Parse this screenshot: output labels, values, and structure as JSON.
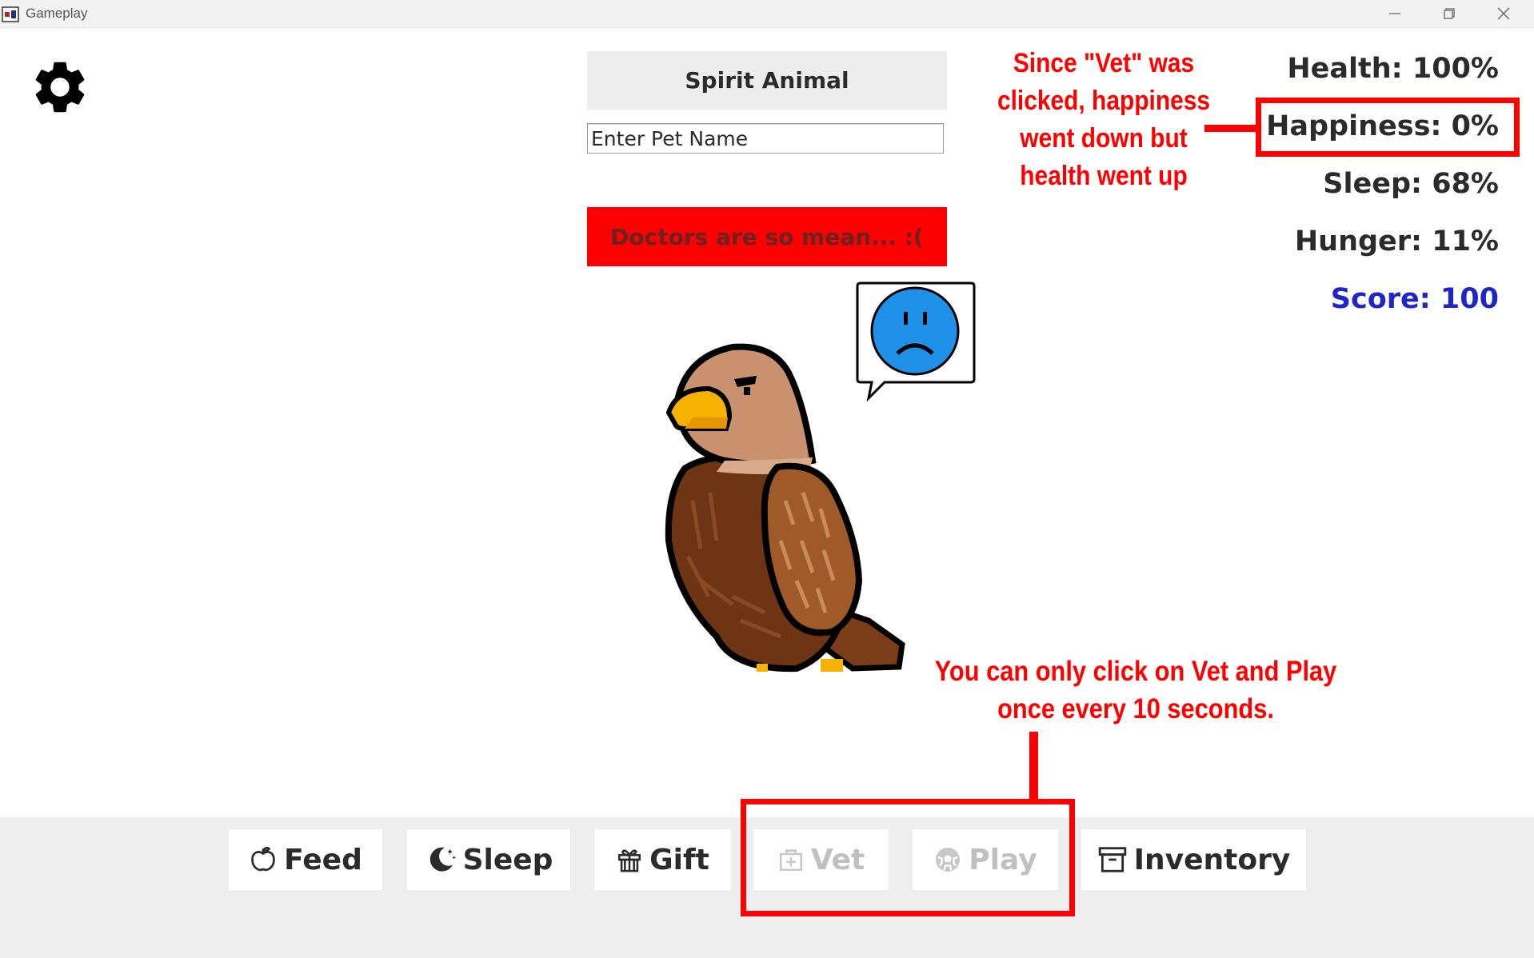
{
  "window": {
    "title": "Gameplay",
    "app_icon": "app-icon",
    "controls": [
      "minimize-icon",
      "maximize-icon",
      "close-icon"
    ]
  },
  "settings": {
    "icon": "gear-icon"
  },
  "pet": {
    "type_button": "Spirit Animal",
    "name_placeholder": "Enter Pet Name",
    "message": "Doctors are so mean... :(",
    "mood_icon": "sad-face-icon",
    "message_color": "#ff0000"
  },
  "stats": {
    "health": "Health: 100%",
    "happiness": "Happiness: 0%",
    "sleep": "Sleep: 68%",
    "hunger": "Hunger: 11%",
    "score": "Score: 100",
    "score_color": "#1f25c7"
  },
  "annotations": {
    "top": "Since \"Vet\" was clicked, happiness went down but health went up",
    "bottom": "You can only click on Vet and Play once every 10 seconds.",
    "color": "#ff0000"
  },
  "actions": {
    "feed": {
      "label": "Feed",
      "icon": "apple-icon",
      "enabled": true
    },
    "sleep": {
      "label": "Sleep",
      "icon": "moon-icon",
      "enabled": true
    },
    "gift": {
      "label": "Gift",
      "icon": "gift-icon",
      "enabled": true
    },
    "vet": {
      "label": "Vet",
      "icon": "medical-kit-icon",
      "enabled": false
    },
    "play": {
      "label": "Play",
      "icon": "soccer-ball-icon",
      "enabled": false
    },
    "inventory": {
      "label": "Inventory",
      "icon": "archive-box-icon",
      "enabled": true
    }
  }
}
